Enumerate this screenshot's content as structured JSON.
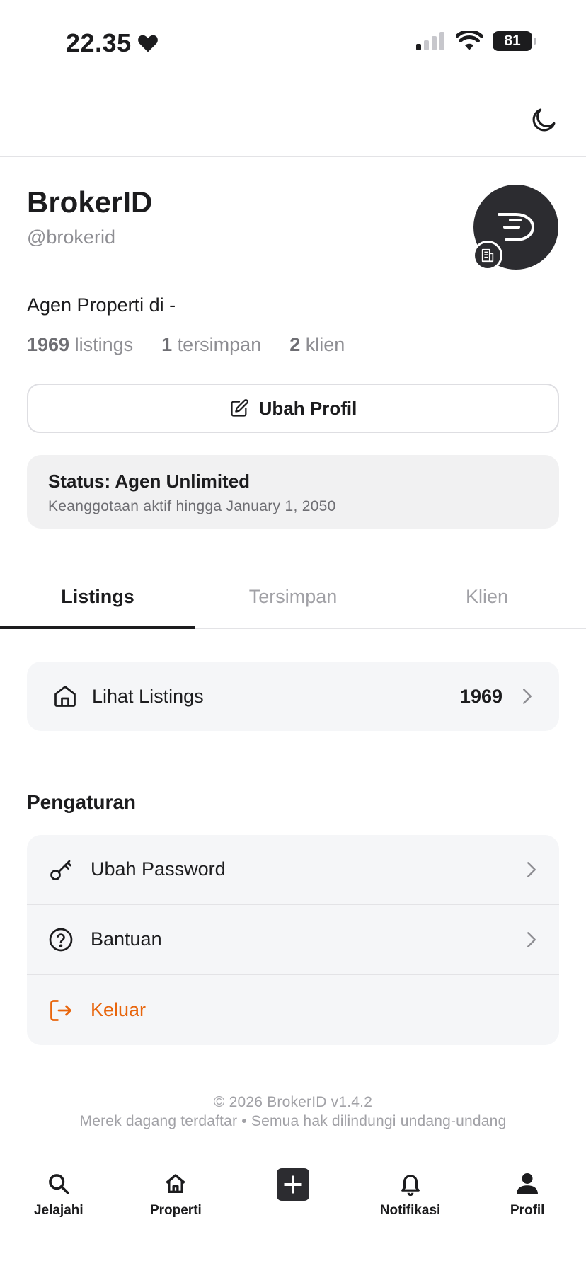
{
  "status_bar": {
    "time": "22.35",
    "battery": "81"
  },
  "profile": {
    "name": "BrokerID",
    "handle": "@brokerid",
    "bio": "Agen Properti di -",
    "stats": {
      "listings_count": "1969",
      "listings_label": "listings",
      "saved_count": "1",
      "saved_label": "tersimpan",
      "clients_count": "2",
      "clients_label": "klien"
    },
    "edit_button": "Ubah Profil"
  },
  "membership": {
    "title": "Status: Agen Unlimited",
    "subtitle": "Keanggotaan aktif hingga January 1, 2050"
  },
  "tabs": [
    {
      "label": "Listings",
      "active": true
    },
    {
      "label": "Tersimpan",
      "active": false
    },
    {
      "label": "Klien",
      "active": false
    }
  ],
  "listings_card": {
    "label": "Lihat Listings",
    "count": "1969"
  },
  "settings": {
    "title": "Pengaturan",
    "items": [
      {
        "label": "Ubah Password",
        "icon": "key-icon"
      },
      {
        "label": "Bantuan",
        "icon": "help-circle-icon"
      },
      {
        "label": "Keluar",
        "icon": "logout-icon"
      }
    ]
  },
  "footer": {
    "line1": "© 2026 BrokerID v1.4.2",
    "line2": "Merek dagang terdaftar • Semua hak dilindungi undang-undang"
  },
  "bottom_nav": [
    {
      "label": "Jelajahi",
      "icon": "search-icon"
    },
    {
      "label": "Properti",
      "icon": "home-icon"
    },
    {
      "label": "",
      "icon": "plus-square-icon"
    },
    {
      "label": "Notifikasi",
      "icon": "bell-icon"
    },
    {
      "label": "Profil",
      "icon": "user-icon"
    }
  ],
  "colors": {
    "accent_dark": "#2c2c30",
    "danger": "#e8650c",
    "muted": "#8e8e93"
  }
}
